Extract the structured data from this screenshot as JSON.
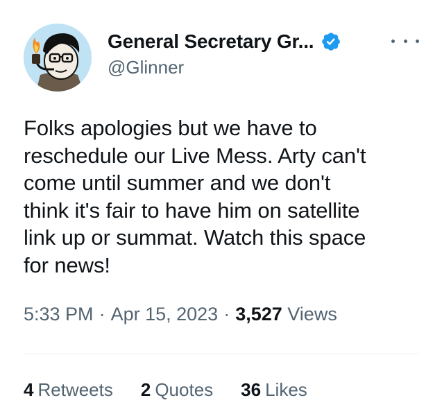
{
  "user": {
    "display_name": "General Secretary Gr...",
    "handle": "@Glinner",
    "verified": true,
    "verified_color": "#1d9bf0"
  },
  "tweet": {
    "text": "Folks apologies but we have to\nreschedule our Live Mess. Arty can't\ncome until summer and we don't\nthink it's fair to have him on satellite\nlink up or summat. Watch this space\nfor news!"
  },
  "meta": {
    "time": "5:33 PM",
    "separator": "·",
    "date": "Apr 15, 2023",
    "views_count": "3,527",
    "views_label": "Views"
  },
  "stats": {
    "retweets_count": "4",
    "retweets_label": "Retweets",
    "quotes_count": "2",
    "quotes_label": "Quotes",
    "likes_count": "36",
    "likes_label": "Likes"
  },
  "icons": {
    "verified": "verified-badge-icon",
    "more": "more-options-icon"
  }
}
